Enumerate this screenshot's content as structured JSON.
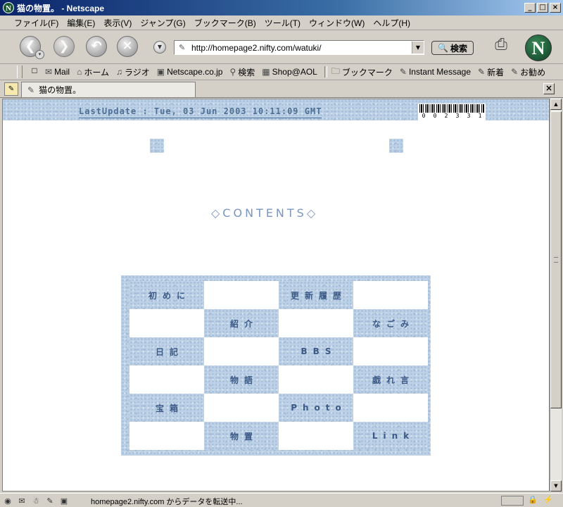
{
  "window": {
    "title": "猫の物置。 - Netscape",
    "app_icon": "N",
    "controls": [
      "_",
      "□",
      "×"
    ]
  },
  "menu": [
    "ファイル(F)",
    "編集(E)",
    "表示(V)",
    "ジャンプ(G)",
    "ブックマーク(B)",
    "ツール(T)",
    "ウィンドウ(W)",
    "ヘルプ(H)"
  ],
  "nav": {
    "back_icon": "arrow-left-icon",
    "forward_icon": "arrow-right-icon",
    "reload_icon": "reload-icon",
    "stop_icon": "stop-icon",
    "url": "http://homepage2.nifty.com/watuki/",
    "search_label": "検索",
    "logo": "N"
  },
  "personal_toolbar": {
    "items": [
      "Mail",
      "ホーム",
      "ラジオ",
      "Netscape.co.jp",
      "検索",
      "Shop@AOL",
      "ブックマーク",
      "Instant Message",
      "新着",
      "お勧め"
    ]
  },
  "tabs": [
    {
      "label": "猫の物置。"
    }
  ],
  "page": {
    "last_update": "LastUpdate : Tue, 03 Jun 2003 10:11:09 GMT",
    "counter_digits": [
      "0",
      "0",
      "2",
      "3",
      "3",
      "1"
    ],
    "contents_title": "◇CONTENTS◇",
    "menu_grid": [
      [
        "初めに",
        "",
        "更新履歴",
        ""
      ],
      [
        "",
        "紹介",
        "",
        "なごみ"
      ],
      [
        "日記",
        "",
        "BBS",
        ""
      ],
      [
        "",
        "物語",
        "",
        "戯れ言"
      ],
      [
        "宝箱",
        "",
        "Photo",
        ""
      ],
      [
        "",
        "物置",
        "",
        "Link"
      ]
    ]
  },
  "status": {
    "text": "homepage2.nifty.com からデータを転送中..."
  },
  "colors": {
    "accent": "#3b5a86",
    "title_blue": "#7a96c0",
    "marble": "#bcd0e6"
  }
}
